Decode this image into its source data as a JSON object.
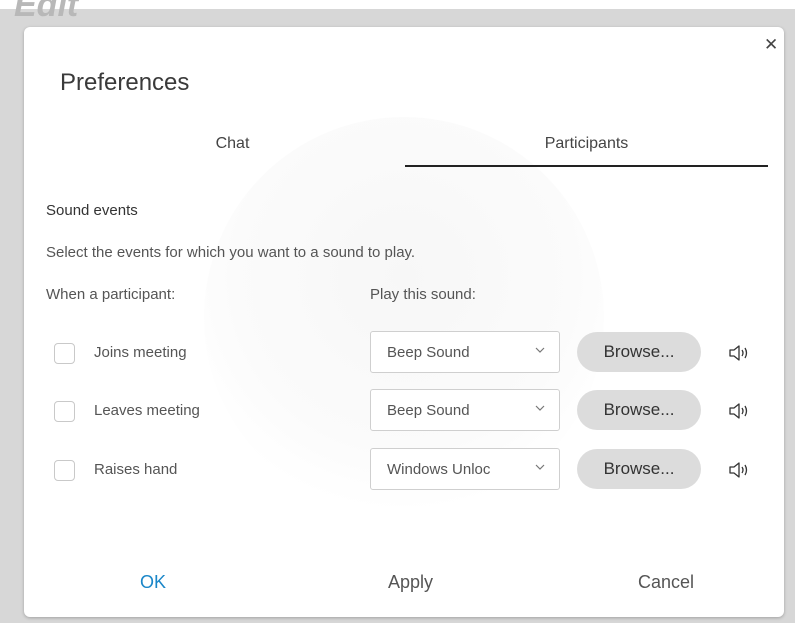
{
  "header_fragment": "Edit",
  "dialog": {
    "title": "Preferences",
    "close_icon": "close-icon",
    "tabs": [
      {
        "label": "Chat",
        "selected": false
      },
      {
        "label": "Participants",
        "selected": true
      }
    ],
    "section_title": "Sound events",
    "description": "Select the events for which you want to a sound to play.",
    "col_participant": "When a participant:",
    "col_sound": "Play this sound:",
    "rows": [
      {
        "label": "Joins meeting",
        "checked": false,
        "sound": "Beep Sound",
        "browse": "Browse...",
        "icon": "speaker-icon"
      },
      {
        "label": "Leaves meeting",
        "checked": false,
        "sound": "Beep Sound",
        "browse": "Browse...",
        "icon": "speaker-icon"
      },
      {
        "label": "Raises hand",
        "checked": false,
        "sound": "Windows Unloc",
        "browse": "Browse...",
        "icon": "speaker-icon"
      }
    ],
    "buttons": {
      "ok": "OK",
      "apply": "Apply",
      "cancel": "Cancel"
    },
    "colors": {
      "accent": "#1a86c8",
      "tab_underline": "#222222",
      "browse_bg": "#dcdcdc"
    }
  }
}
